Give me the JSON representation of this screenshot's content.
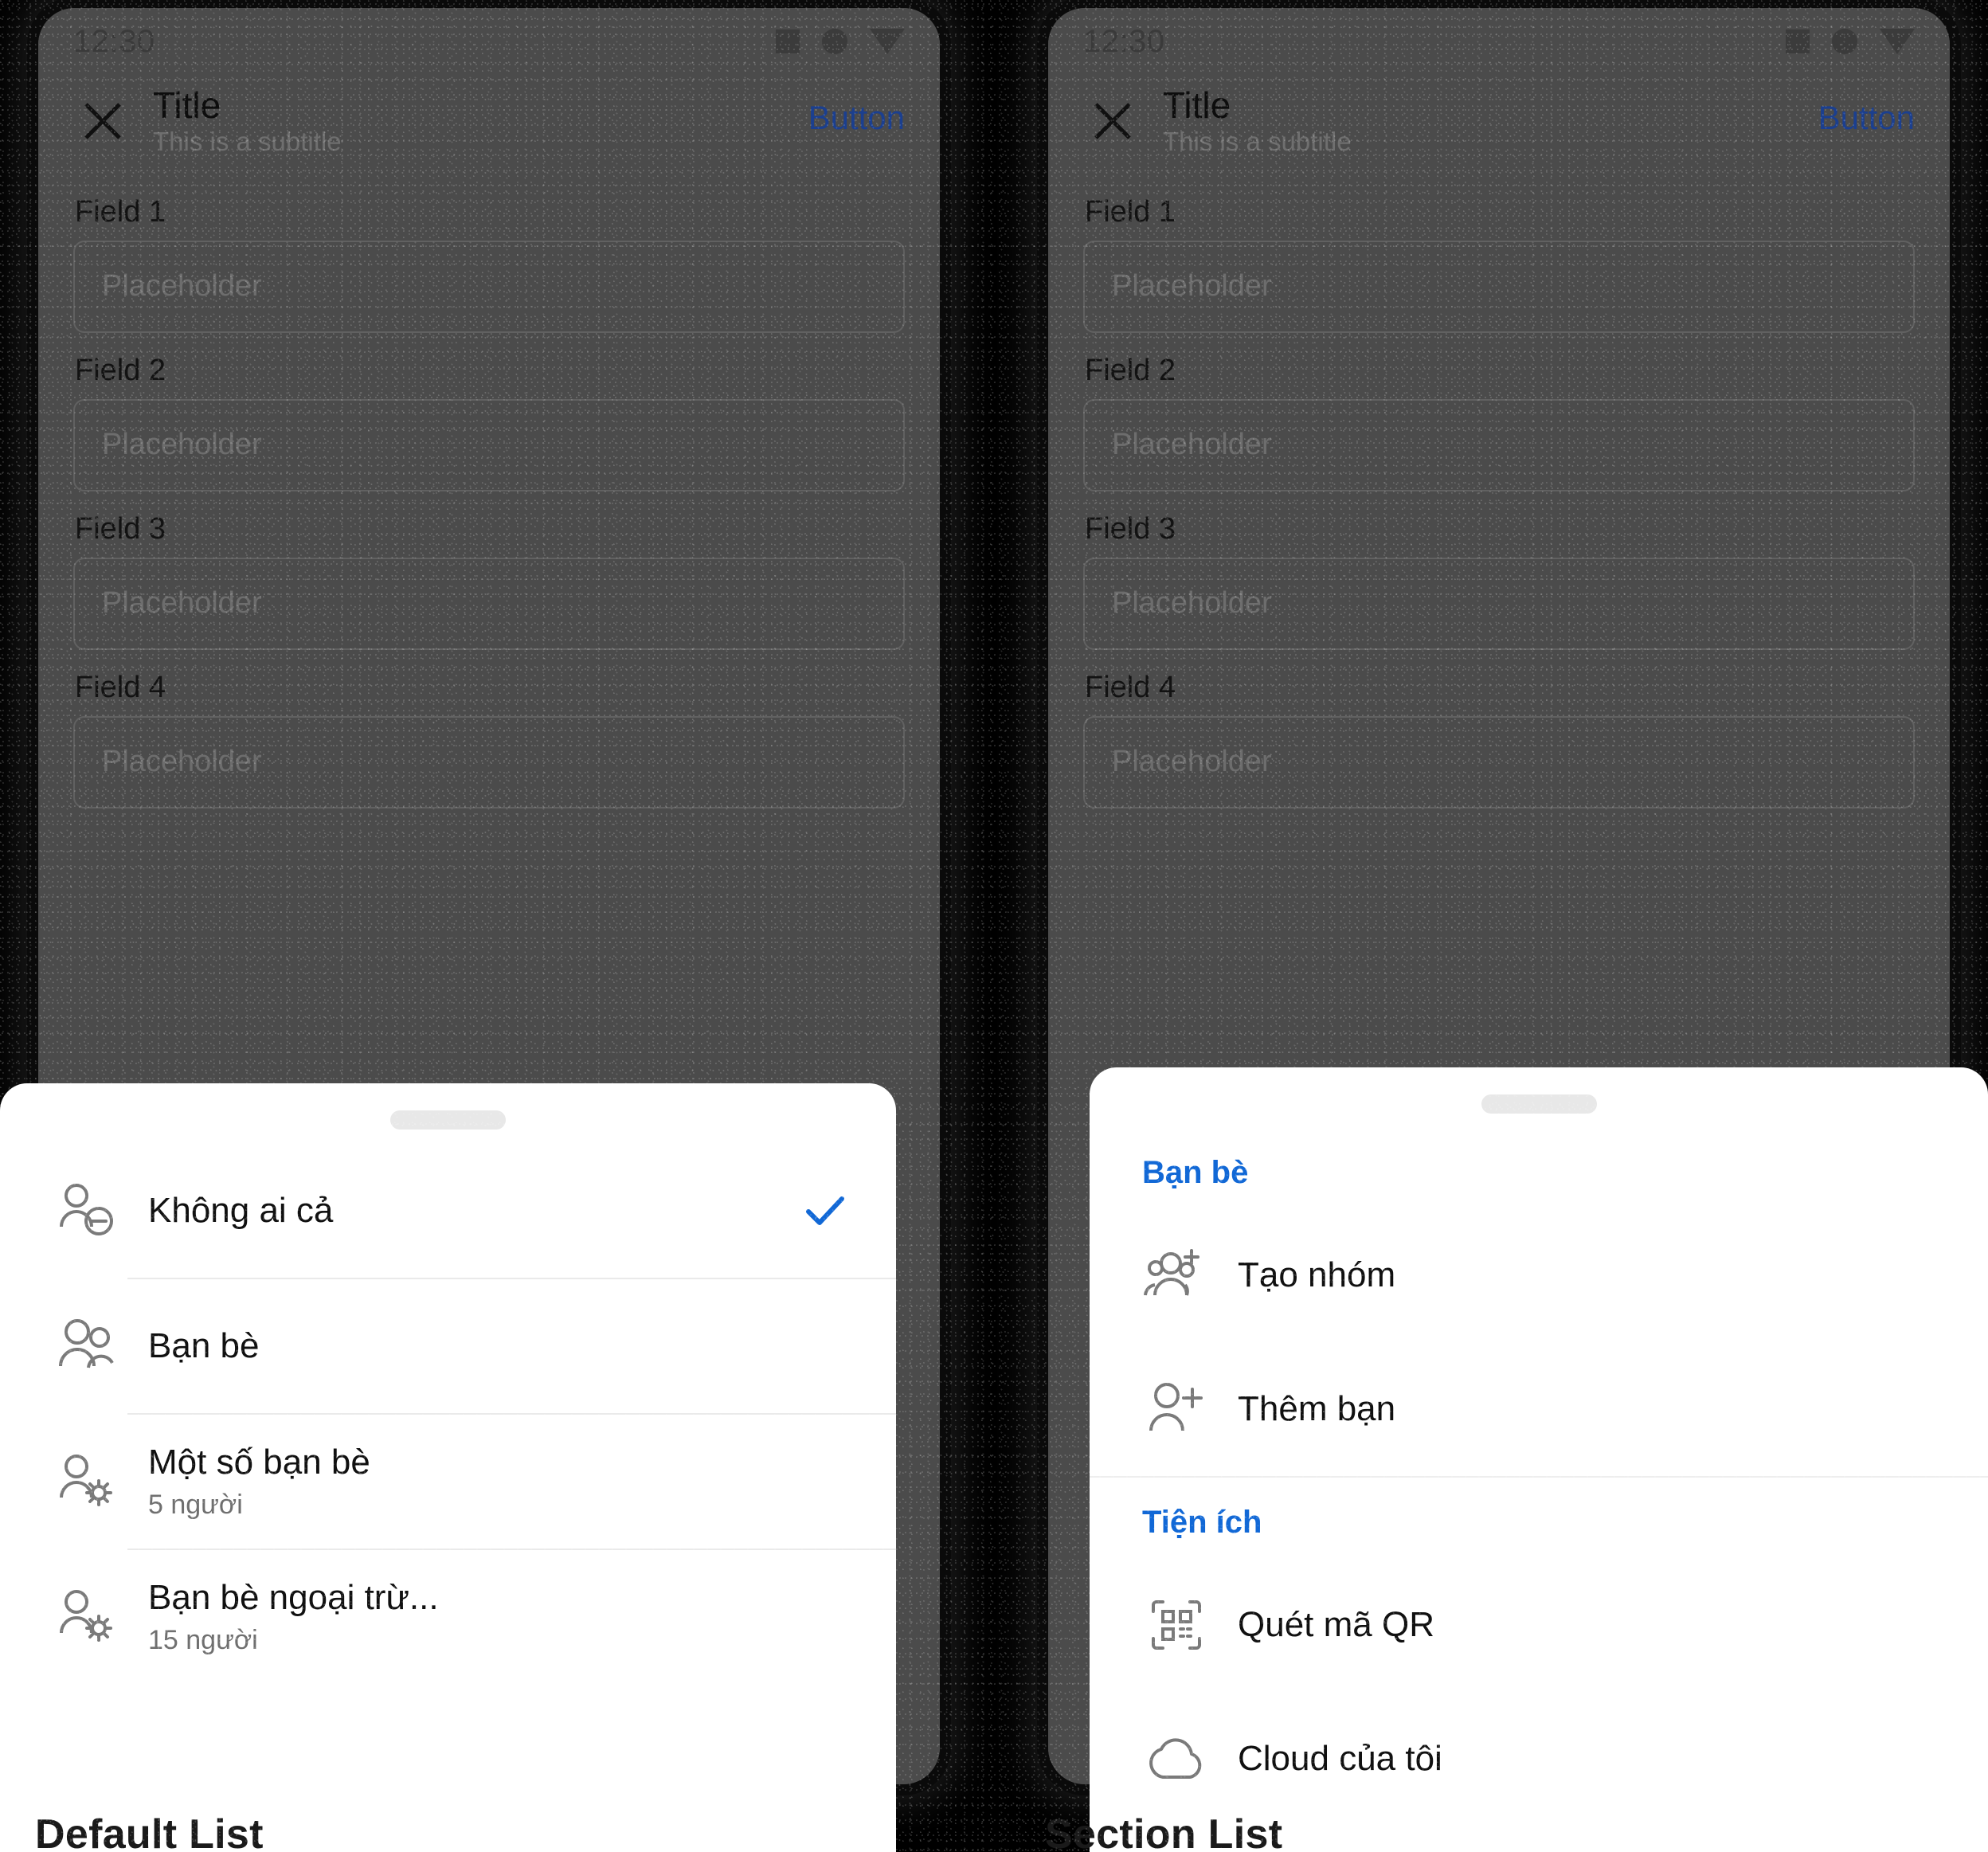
{
  "colors": {
    "accent": "#1168d6",
    "link": "#1b3f8f",
    "sheet_bg": "#ffffff",
    "screen_dim": "#4b4b4b",
    "page_bg": "#000000",
    "divider": "#eaeaea",
    "handle": "#e8e8e8"
  },
  "captions": {
    "left": "Default List",
    "right": "Section List"
  },
  "phone": {
    "statusbar": {
      "time": "12:30",
      "icons": [
        "square-icon",
        "circle-icon",
        "triangle-down-icon"
      ]
    },
    "appbar": {
      "close_icon": "close-icon",
      "title": "Title",
      "subtitle": "This is a subtitle",
      "action_label": "Button"
    },
    "fields": [
      {
        "label": "Field 1",
        "value": "",
        "placeholder": "Placeholder"
      },
      {
        "label": "Field 2",
        "value": "",
        "placeholder": "Placeholder"
      },
      {
        "label": "Field 3",
        "value": "",
        "placeholder": "Placeholder"
      },
      {
        "label": "Field 4",
        "value": "",
        "placeholder": "Placeholder"
      }
    ]
  },
  "default_sheet": {
    "handle": "drag-handle",
    "items": [
      {
        "icon": "person-minus-icon",
        "title": "Không ai cả",
        "subtitle": "",
        "selected": true,
        "check_icon": "check-icon"
      },
      {
        "icon": "people-icon",
        "title": "Bạn bè",
        "subtitle": "",
        "selected": false
      },
      {
        "icon": "person-gear-icon",
        "title": "Một số bạn bè",
        "subtitle": "5 người",
        "selected": false
      },
      {
        "icon": "person-gear-icon",
        "title": "Bạn bè ngoại trừ...",
        "subtitle": "15 người",
        "selected": false
      }
    ]
  },
  "section_sheet": {
    "handle": "drag-handle",
    "sections": [
      {
        "header": "Bạn bè",
        "items": [
          {
            "icon": "group-add-icon",
            "title": "Tạo nhóm"
          },
          {
            "icon": "person-add-icon",
            "title": "Thêm bạn"
          }
        ]
      },
      {
        "header": "Tiện ích",
        "items": [
          {
            "icon": "qr-scan-icon",
            "title": "Quét mã QR"
          },
          {
            "icon": "cloud-icon",
            "title": "Cloud của tôi"
          }
        ]
      }
    ]
  }
}
